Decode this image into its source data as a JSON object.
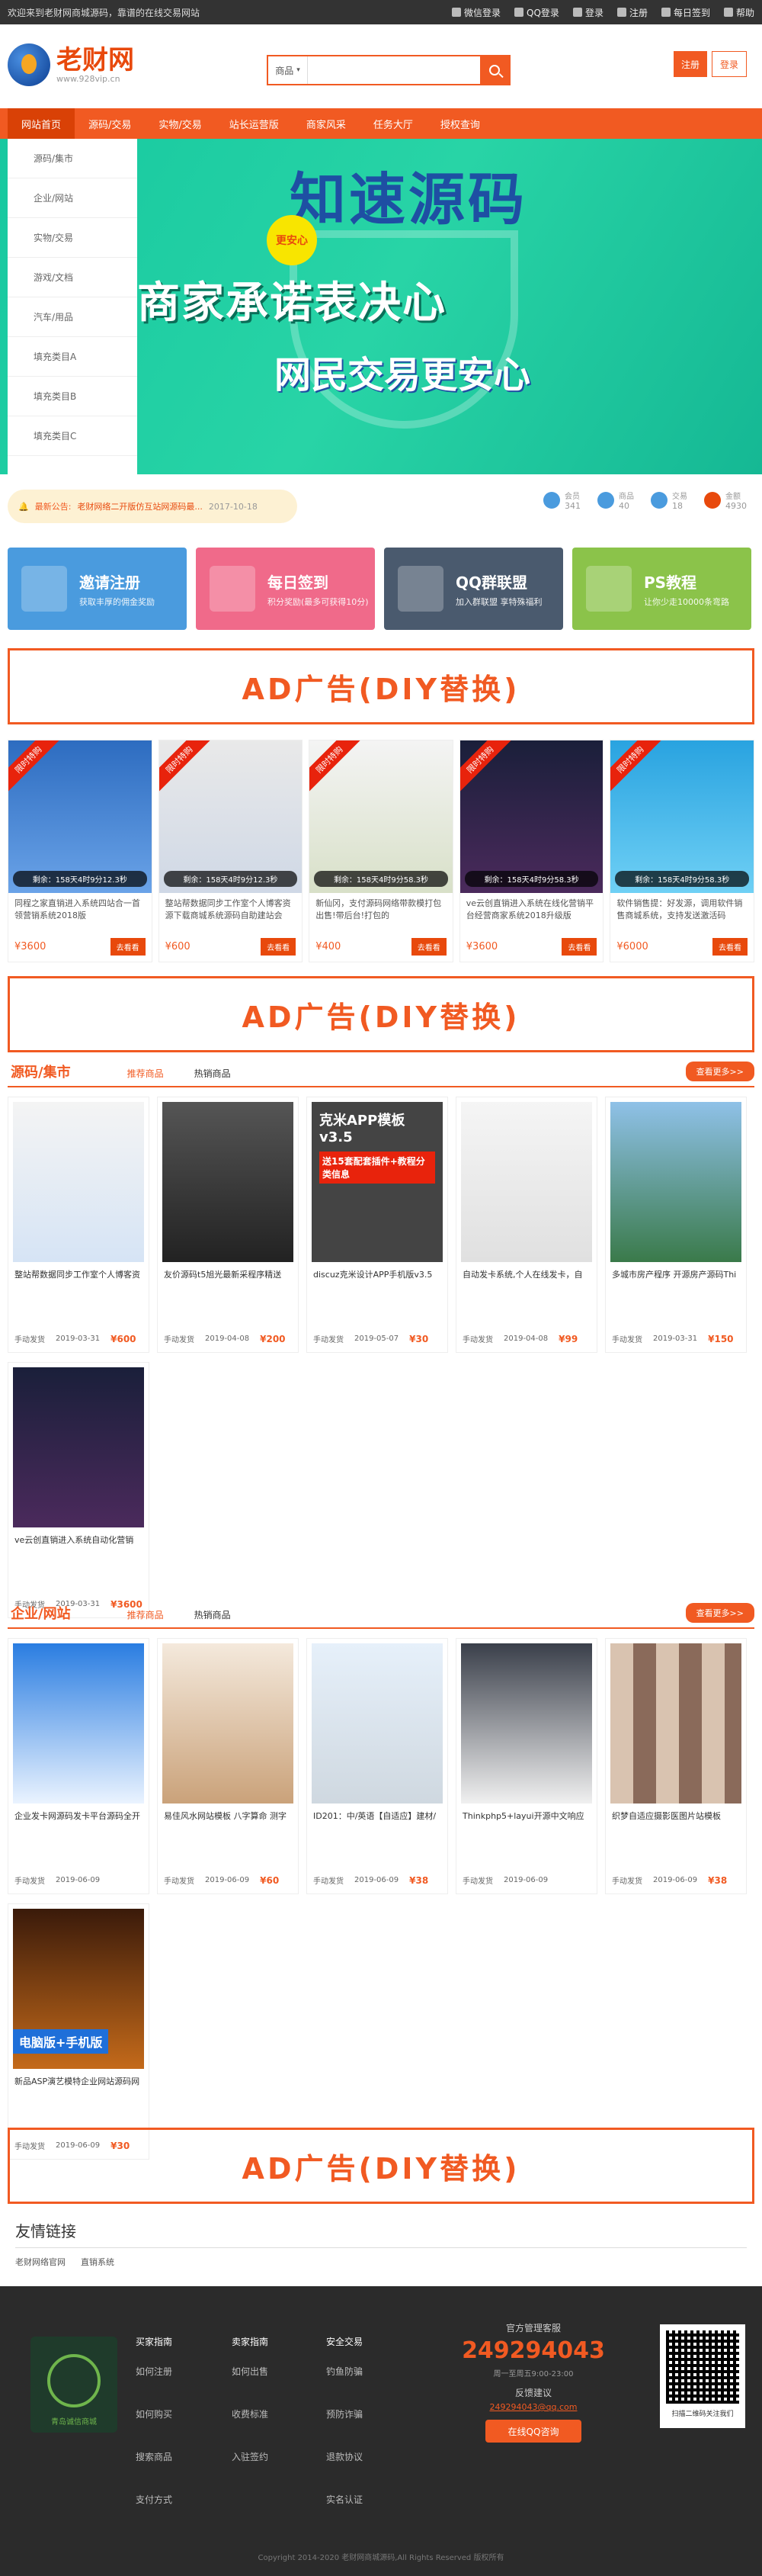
{
  "topbar": {
    "slogan": "欢迎来到老财网商城源码，靠谱的在线交易网站",
    "links": [
      "微信登录",
      "QQ登录",
      "登录",
      "注册",
      "每日签到",
      "帮助"
    ]
  },
  "header": {
    "logo_title": "老财网",
    "logo_url": "www.928vip.cn",
    "search_type": "商品",
    "search_placeholder": "",
    "register": "注册",
    "login": "登录"
  },
  "nav": {
    "items": [
      "网站首页",
      "源码/交易",
      "实物/交易",
      "站长运营版",
      "商家风采",
      "任务大厅",
      "授权查询"
    ]
  },
  "banner": {
    "sidebar": [
      "源码/集市",
      "企业/网站",
      "实物/交易",
      "游戏/文档",
      "汽车/用品",
      "填充类目A",
      "填充类目B",
      "填充类目C"
    ],
    "title": "知速源码",
    "seal": "更安心",
    "line2": "商家承诺表决心",
    "line3": "网民交易更安心"
  },
  "notice": {
    "label": "最新公告:",
    "text": "老财网络二开版仿互站网源码最...",
    "date": "2017-10-18",
    "stats": [
      {
        "label": "会员",
        "value": "341"
      },
      {
        "label": "商品",
        "value": "40"
      },
      {
        "label": "交易",
        "value": "18"
      },
      {
        "label": "金额",
        "value": "4930"
      }
    ]
  },
  "features": [
    {
      "title": "邀请注册",
      "sub": "获取丰厚的佣金奖励",
      "color": "#4a9bde"
    },
    {
      "title": "每日签到",
      "sub": "积分奖励(最多可获得10分)",
      "color": "#f06a8a"
    },
    {
      "title": "QQ群联盟",
      "sub": "加入群联盟 享特殊福利",
      "color": "#4a5a6e"
    },
    {
      "title": "PS教程",
      "sub": "让你少走10000条弯路",
      "color": "#8bc34a"
    }
  ],
  "ad": {
    "text": "AD广告(DIY替换)"
  },
  "promo": {
    "ribbon": "限时特购",
    "items": [
      {
        "countdown": "剩余：158天4时9分12.3秒",
        "title": "同程之家直销进入系统四站合一首领营销系统2018版",
        "price": "¥3600",
        "btn": "去看看"
      },
      {
        "countdown": "剩余：158天4时9分12.3秒",
        "title": "整站帮数据同步工作室个人博客资源下载商城系统源码自助建站会员...",
        "price": "¥600",
        "btn": "去看看"
      },
      {
        "countdown": "剩余：158天4时9分58.3秒",
        "title": "新仙冈，支付源码网络带款模打包出售!带后台!打包的",
        "price": "¥400",
        "btn": "去看看"
      },
      {
        "countdown": "剩余：158天4时9分58.3秒",
        "title": "ve云创直销进入系统在线化营销平台经营商家系统2018升级版",
        "price": "¥3600",
        "btn": "去看看"
      },
      {
        "countdown": "剩余：158天4时9分58.3秒",
        "title": "软件销售提：好发源，调用软件销售商城系统，支持发送激活码",
        "price": "¥6000",
        "btn": "去看看"
      }
    ]
  },
  "section1": {
    "title": "源码/集市",
    "tabs": [
      "推荐商品",
      "热销商品"
    ],
    "more": "查看更多>>",
    "items": [
      {
        "title": "整站帮数据同步工作室个人博客资",
        "tag": "手动发货",
        "date": "2019-03-31",
        "price": "¥600"
      },
      {
        "title": "友价源码t5旭光最新采程序精送",
        "tag": "手动发货",
        "date": "2019-04-08",
        "price": "¥200"
      },
      {
        "title": "discuz克米设计APP手机版v3.5",
        "tag": "手动发货",
        "date": "2019-05-07",
        "price": "¥30"
      },
      {
        "title": "自动发卡系统,个人在线发卡，自",
        "tag": "手动发货",
        "date": "2019-04-08",
        "price": "¥99"
      },
      {
        "title": "多城市房产程序 开源房产源码Thi",
        "tag": "手动发货",
        "date": "2019-03-31",
        "price": "¥150"
      },
      {
        "title": "ve云创直销进入系统自动化营销",
        "tag": "手动发货",
        "date": "2019-03-31",
        "price": "¥3600"
      }
    ],
    "img_texts": [
      "克米APP模板v3.5",
      "送15套配套插件+教程分类信息"
    ]
  },
  "section2": {
    "title": "企业/网站",
    "tabs": [
      "推荐商品",
      "热销商品"
    ],
    "more": "查看更多>>",
    "items": [
      {
        "title": "企业发卡网源码发卡平台源码全开",
        "tag": "手动发货",
        "date": "2019-06-09",
        "price": ""
      },
      {
        "title": "易佳风水网站模板 八字算命 测字",
        "tag": "手动发货",
        "date": "2019-06-09",
        "price": "¥60"
      },
      {
        "title": "ID201：中/英语【自适应】建材/",
        "tag": "手动发货",
        "date": "2019-06-09",
        "price": "¥38"
      },
      {
        "title": "Thinkphp5+layui开源中文响应",
        "tag": "手动发货",
        "date": "2019-06-09",
        "price": ""
      },
      {
        "title": "织梦自适应摄影医图片站模板",
        "tag": "手动发货",
        "date": "2019-06-09",
        "price": "¥38"
      },
      {
        "title": "新品ASP演艺模特企业网站源码网",
        "tag": "手动发货",
        "date": "2019-06-09",
        "price": "¥30"
      }
    ],
    "img_text": "电脑版+手机版"
  },
  "friends": {
    "title": "友情链接",
    "links": [
      "老财网络官网",
      "直销系统"
    ]
  },
  "footer": {
    "logo_text": "青岛诚信商城",
    "cols": [
      {
        "head": "买家指南",
        "items": [
          "如何注册",
          "如何购买",
          "搜索商品",
          "支付方式"
        ]
      },
      {
        "head": "卖家指南",
        "items": [
          "如何出售",
          "收费标准",
          "入驻签约"
        ]
      },
      {
        "head": "安全交易",
        "items": [
          "钓鱼防骗",
          "预防诈骗",
          "退款协议",
          "实名认证"
        ]
      }
    ],
    "contact_title": "官方管理客服",
    "phone": "249294043",
    "hours": "周一至周五9:00-23:00",
    "feedback": "反馈建议",
    "email": "249294043@qq.com",
    "qq_btn": "在线QQ咨询",
    "qr_caption": "扫描二维码关注我们",
    "copyright": "Copyright 2014-2020 老财网商城源码,All Rights Reserved 版权所有"
  }
}
